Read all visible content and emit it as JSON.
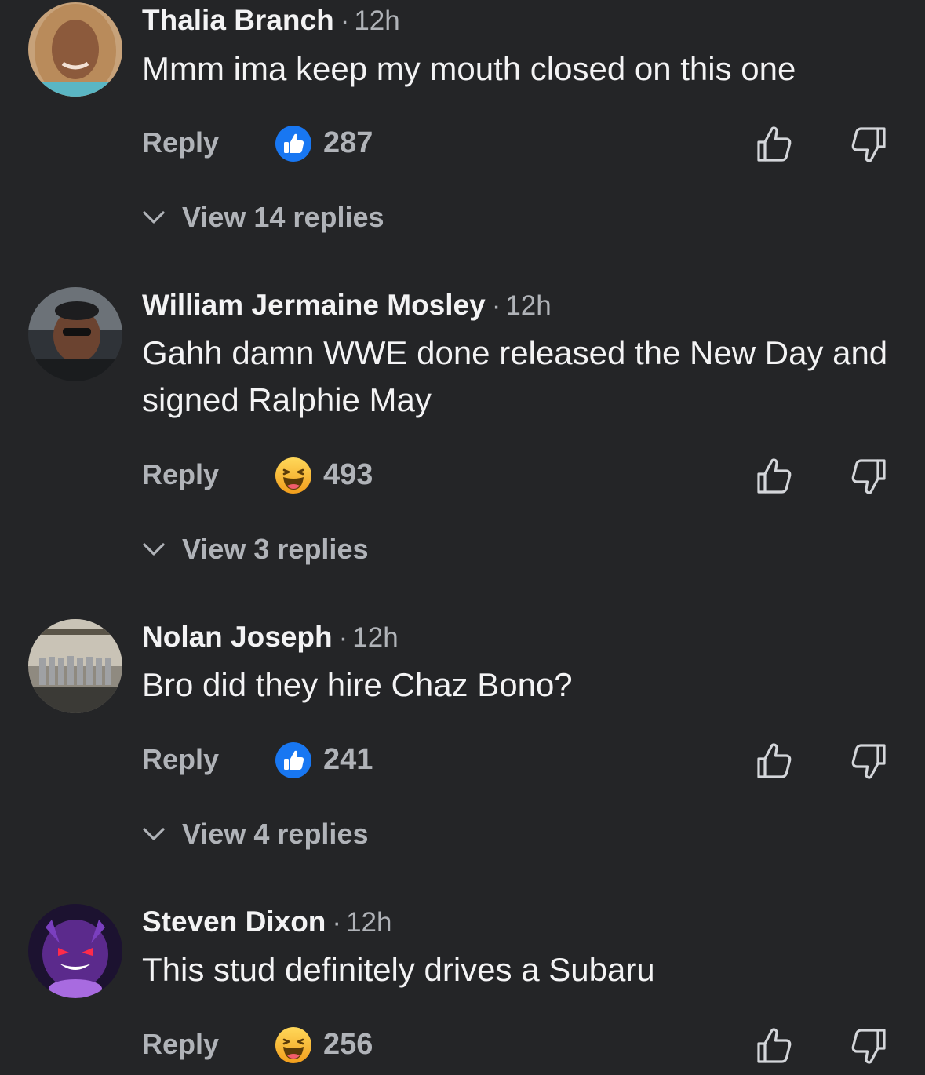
{
  "comments": [
    {
      "author": "Thalia Branch",
      "separator": "·",
      "time": "12h",
      "text": "Mmm ima keep my mouth closed on this one",
      "reply_label": "Reply",
      "reaction": "like",
      "reaction_count": "287",
      "view_replies": "View 14 replies"
    },
    {
      "author": "William Jermaine Mosley",
      "separator": "·",
      "time": "12h",
      "text": "Gahh damn WWE done released the New Day and signed Ralphie May",
      "reply_label": "Reply",
      "reaction": "haha",
      "reaction_count": "493",
      "view_replies": "View 3 replies"
    },
    {
      "author": "Nolan Joseph",
      "separator": "·",
      "time": "12h",
      "text": "Bro did they hire Chaz Bono?",
      "reply_label": "Reply",
      "reaction": "like",
      "reaction_count": "241",
      "view_replies": "View 4 replies"
    },
    {
      "author": "Steven Dixon",
      "separator": "·",
      "time": "12h",
      "text": "This stud definitely drives a Subaru",
      "reply_label": "Reply",
      "reaction": "haha",
      "reaction_count": "256"
    }
  ],
  "colors": {
    "background": "#242527",
    "primary_text": "#f3f3f4",
    "secondary_text": "#b0b3b8",
    "like_blue": "#1877f2",
    "haha_yellow": "#f7b125"
  },
  "icons": {
    "like_reaction": "like-reaction-icon",
    "haha_reaction": "haha-reaction-icon",
    "upvote": "thumbs-up-outline-icon",
    "downvote": "thumbs-down-outline-icon",
    "expand": "chevron-down-icon"
  }
}
